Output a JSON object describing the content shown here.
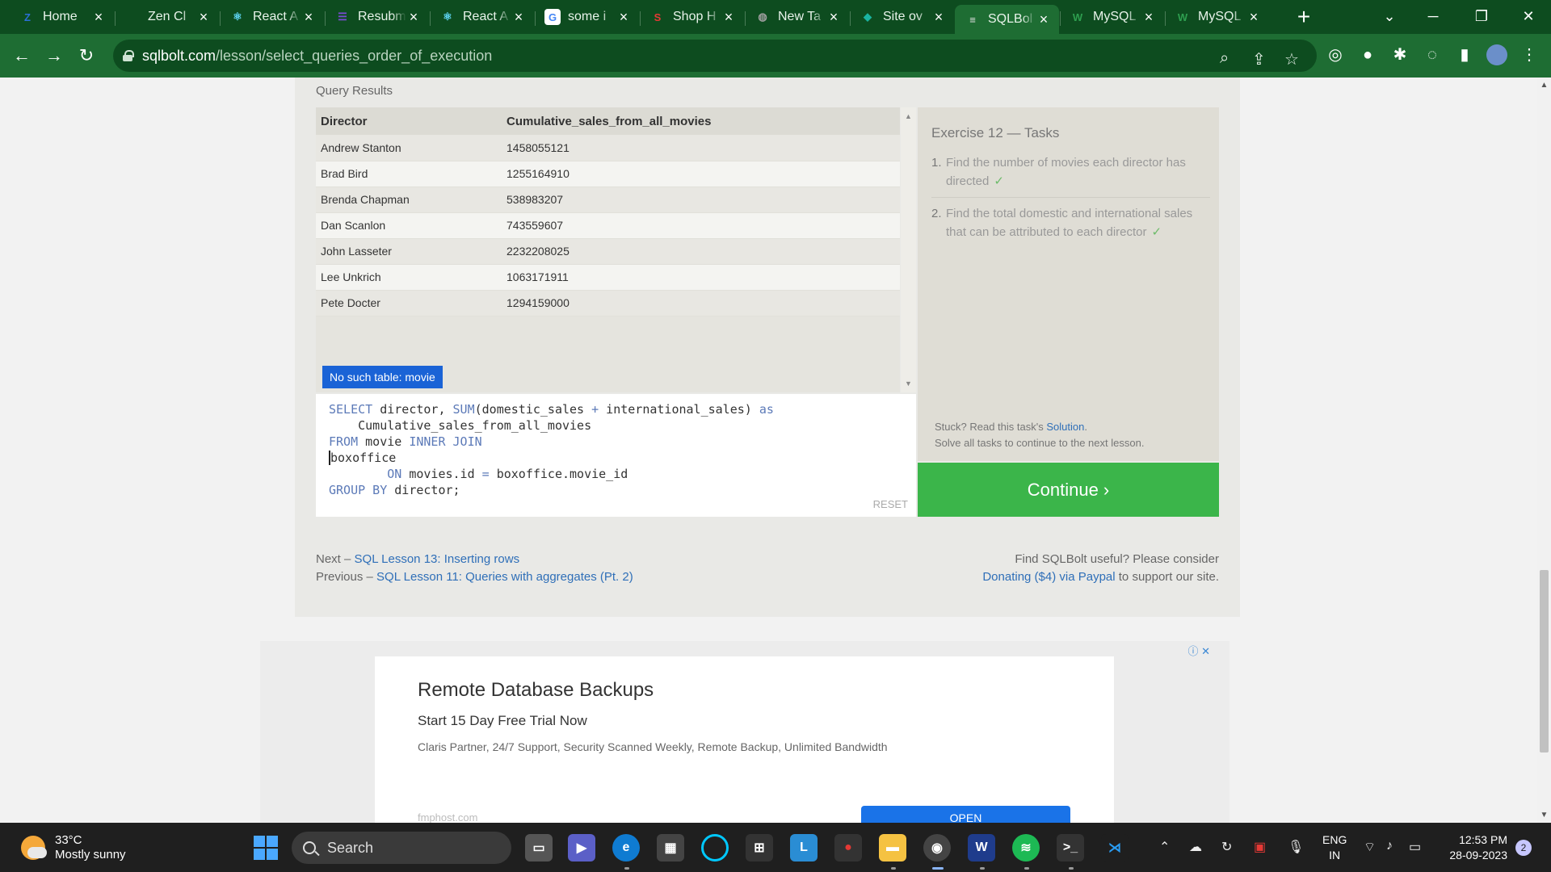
{
  "browser": {
    "tabs": [
      {
        "title": "Home",
        "icon": "zen-icon",
        "color": "#2b6fd6",
        "glyph": "Z"
      },
      {
        "title": "Zen Cl",
        "icon": "blank-icon",
        "color": "#0d4c1f",
        "glyph": ""
      },
      {
        "title": "React A",
        "icon": "react-icon",
        "color": "#61dafb",
        "glyph": "⚛"
      },
      {
        "title": "Resubm",
        "icon": "list-icon",
        "color": "#7b4bd6",
        "glyph": "☰"
      },
      {
        "title": "React A",
        "icon": "react-icon",
        "color": "#61dafb",
        "glyph": "⚛"
      },
      {
        "title": "some i",
        "icon": "google-icon",
        "color": "#ffffff",
        "glyph": "G"
      },
      {
        "title": "Shop H",
        "icon": "shop-icon",
        "color": "#e53935",
        "glyph": "S"
      },
      {
        "title": "New Ta",
        "icon": "globe-icon",
        "color": "#9e9e9e",
        "glyph": "◍"
      },
      {
        "title": "Site ov",
        "icon": "diamond-icon",
        "color": "#1ab3a0",
        "glyph": "◆"
      },
      {
        "title": "SQLBol",
        "icon": "database-icon",
        "color": "#e0e0e0",
        "glyph": "≡",
        "active": true
      },
      {
        "title": "MySQL",
        "icon": "w3-icon",
        "color": "#2e9e4f",
        "glyph": "W"
      },
      {
        "title": "MySQL",
        "icon": "w3-icon",
        "color": "#2e9e4f",
        "glyph": "W"
      }
    ],
    "url_host": "sqlbolt.com",
    "url_path": "/lesson/select_queries_order_of_execution"
  },
  "results": {
    "label": "Query Results",
    "columns": [
      "Director",
      "Cumulative_sales_from_all_movies"
    ],
    "rows": [
      [
        "Andrew Stanton",
        "1458055121"
      ],
      [
        "Brad Bird",
        "1255164910"
      ],
      [
        "Brenda Chapman",
        "538983207"
      ],
      [
        "Dan Scanlon",
        "743559607"
      ],
      [
        "John Lasseter",
        "2232208025"
      ],
      [
        "Lee Unkrich",
        "1063171911"
      ],
      [
        "Pete Docter",
        "1294159000"
      ]
    ],
    "error": "No such table: movie"
  },
  "editor": {
    "reset_label": "RESET"
  },
  "tasks": {
    "title": "Exercise 12 — Tasks",
    "items": [
      {
        "num": "1.",
        "text": "Find the number of movies each director has directed",
        "check": "✓"
      },
      {
        "num": "2.",
        "text": "Find the total domestic and international sales that can be attributed to each director",
        "check": "✓"
      }
    ],
    "stuck_prefix": "Stuck? Read this task's ",
    "solution_link": "Solution",
    "stuck_suffix": ".",
    "solve_all": "Solve all tasks to continue to the next lesson.",
    "continue_label": "Continue ›"
  },
  "footer": {
    "next_prefix": "Next – ",
    "next_link": "SQL Lesson 13: Inserting rows",
    "prev_prefix": "Previous – ",
    "prev_link": "SQL Lesson 11: Queries with aggregates (Pt. 2)",
    "support_line1": "Find SQLBolt useful? Please consider",
    "donate_link": "Donating ($4) via Paypal",
    "support_suffix": " to support our site."
  },
  "ad": {
    "title": "Remote Database Backups",
    "subtitle": "Start 15 Day Free Trial Now",
    "description": "Claris Partner, 24/7 Support, Security Scanned Weekly, Remote Backup, Unlimited Bandwidth",
    "site": "fmphost.com",
    "cta": "OPEN",
    "choices": "ⓘ ✕"
  },
  "taskbar": {
    "temp": "33°C",
    "condition": "Mostly sunny",
    "search_label": "Search",
    "lang1": "ENG",
    "lang2": "IN",
    "time": "12:53 PM",
    "date": "28-09-2023",
    "notifications": "2"
  }
}
